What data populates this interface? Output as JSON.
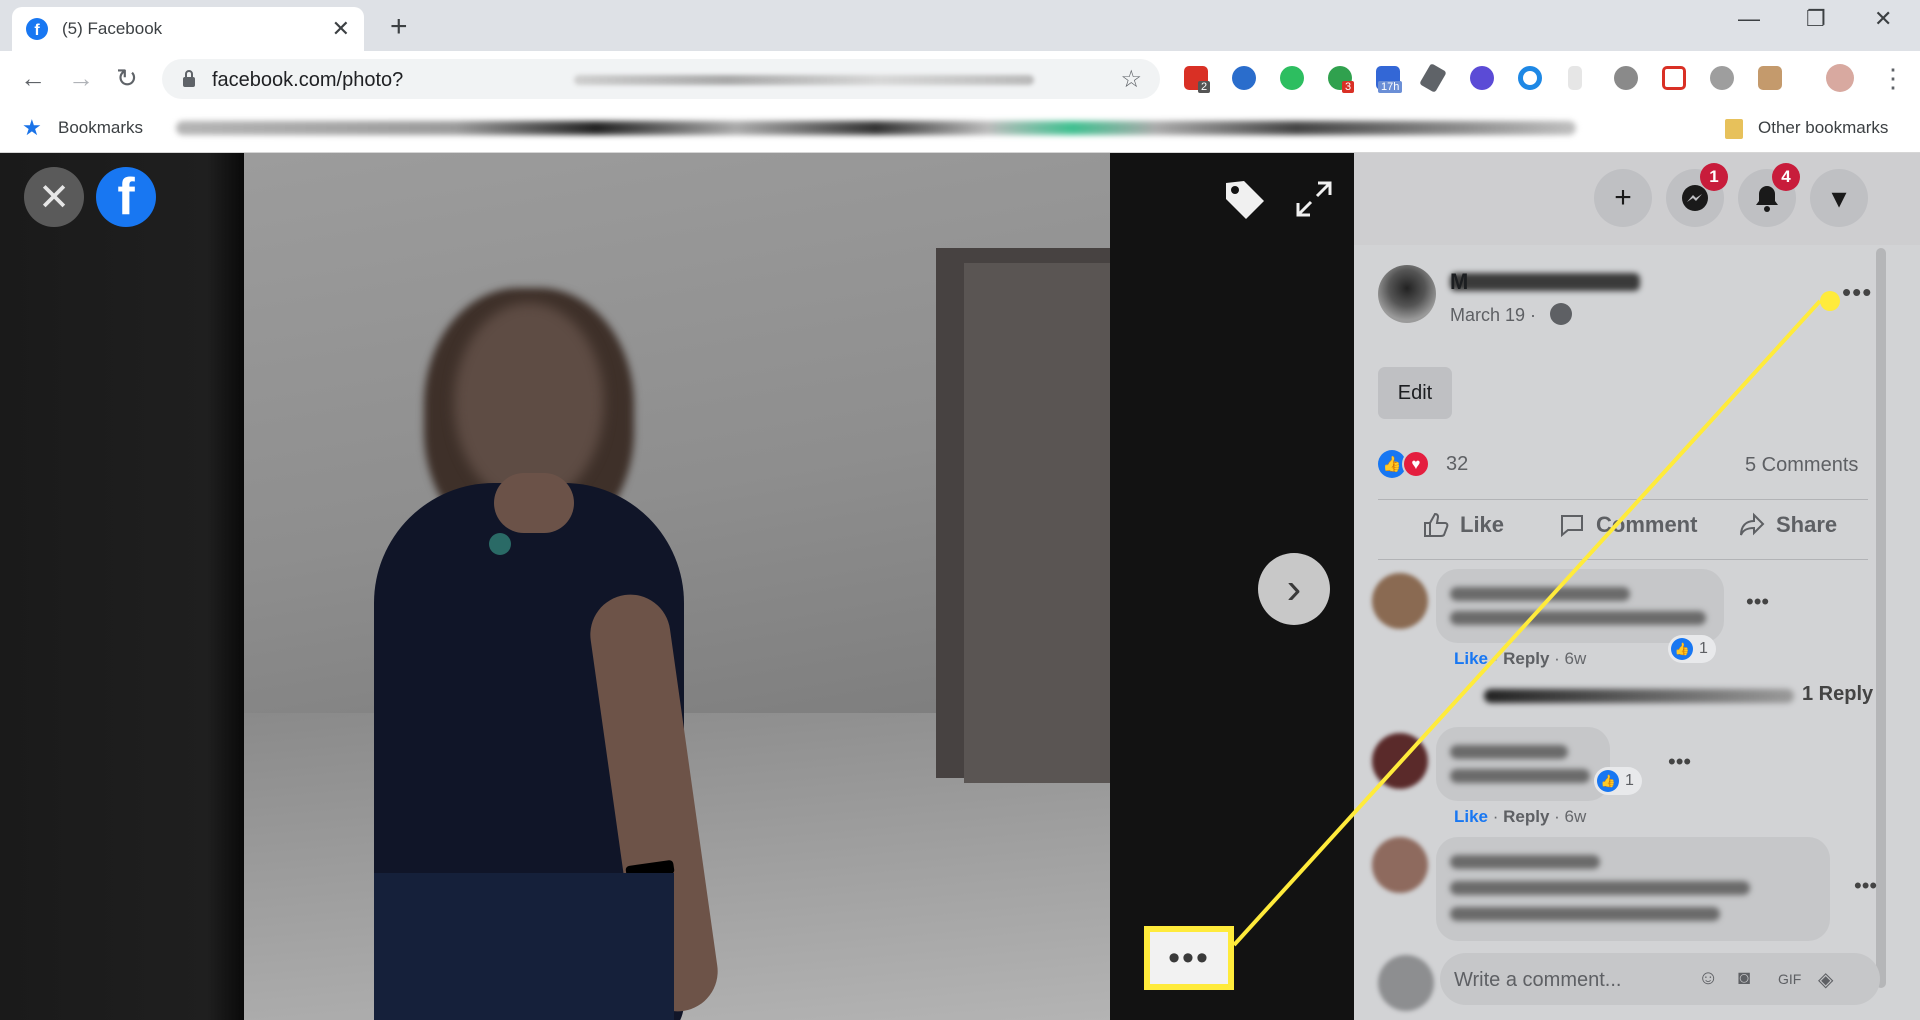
{
  "browser": {
    "tab_title": "(5) Facebook",
    "tab_close": "✕",
    "new_tab": "+",
    "url": "facebook.com/photo?",
    "bookmarks_label": "Bookmarks",
    "other_bookmarks": "Other bookmarks",
    "extension_badges": [
      "2",
      "3",
      "17h"
    ]
  },
  "viewer": {
    "close_glyph": "✕",
    "logo_letter": "f",
    "next_glyph": "›",
    "more_glyph": "•••"
  },
  "sidebar": {
    "create_glyph": "+",
    "messenger_badge": "1",
    "notifications_badge": "4",
    "menu_glyph": "▾",
    "post": {
      "author_initial": "M",
      "date": "March 19 ·",
      "more_glyph": "•••",
      "edit_label": "Edit",
      "reaction_count": "32",
      "comments_count": "5 Comments",
      "actions": {
        "like": "Like",
        "comment": "Comment",
        "share": "Share"
      }
    },
    "comments": [
      {
        "like": "Like",
        "reply": "Reply",
        "age": "6w",
        "reaction_count": "1"
      },
      {
        "like": "Like",
        "reply": "Reply",
        "age": "6w",
        "reaction_count": "1"
      },
      {
        "like": "",
        "reply": "",
        "age": "",
        "reaction_count": ""
      }
    ],
    "view_replies": "1 Reply",
    "write_placeholder": "Write a comment..."
  },
  "colors": {
    "facebook_blue": "#1877f2",
    "badge_red": "#c81c3b",
    "highlight_yellow": "#ffeb3b"
  }
}
